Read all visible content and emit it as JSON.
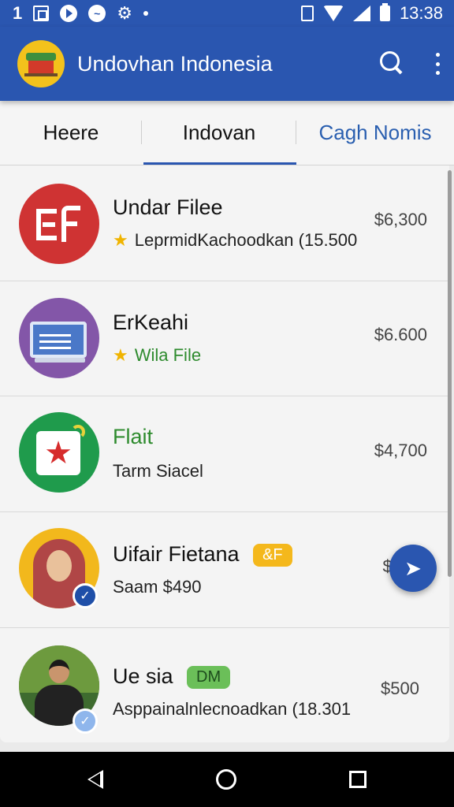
{
  "status_bar": {
    "left_number": "1",
    "time": "13:38",
    "icons": [
      "picture-icon",
      "play-icon",
      "messenger-icon",
      "gear-icon",
      "dot-icon",
      "sim-icon",
      "wifi-icon",
      "signal-icon",
      "battery-icon"
    ]
  },
  "app_bar": {
    "title": "Undovhan Indonesia",
    "color": "#2a56b0",
    "actions": [
      "search-icon",
      "more-icon"
    ]
  },
  "tabs": [
    {
      "label": "Heere"
    },
    {
      "label": "Indovan",
      "active": true
    },
    {
      "label": "Cagh Nomis"
    }
  ],
  "list": [
    {
      "title": "Undar Filee",
      "subtitle": "LeprmidKachoodkan (15.500",
      "price": "$6,300",
      "starred": true
    },
    {
      "title": "ErKeahi",
      "subtitle": "Wila File",
      "price": "$6.600",
      "starred": true,
      "subtitle_color": "#2e8b2e"
    },
    {
      "title": "Flait",
      "subtitle": "Tarm Siacel",
      "price": "$4,700",
      "starred": false,
      "title_color": "#2e8b2e"
    },
    {
      "title": "Uifair Fietana",
      "badge": "&F",
      "subtitle": "Saam $490",
      "price": "$0",
      "verified": true
    },
    {
      "title": "Ue sia",
      "badge": "DM",
      "subtitle": "Asppainalnlecnoadkan (18.301",
      "price": "$500",
      "verified": true
    }
  ],
  "colors": {
    "accent": "#2a56b0",
    "star": "#f0b400",
    "badge_yellow": "#f4b81c",
    "badge_green": "#6bbf59"
  }
}
